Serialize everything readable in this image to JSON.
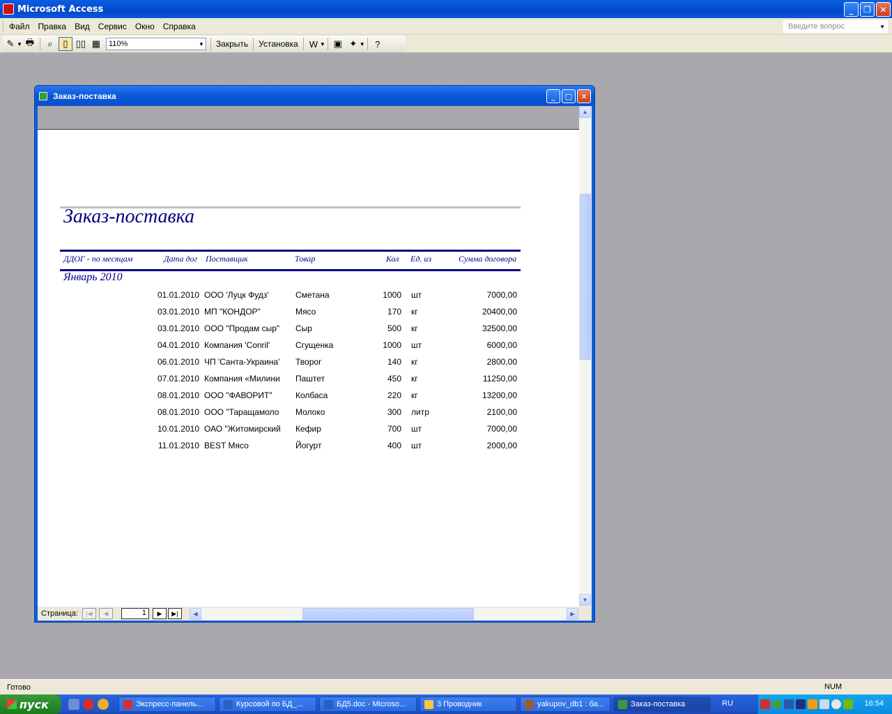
{
  "app": {
    "title": "Microsoft Access",
    "window_buttons": [
      "_",
      "❐",
      "✕"
    ]
  },
  "menu": {
    "items": [
      {
        "label": "Файл"
      },
      {
        "label": "Правка"
      },
      {
        "label": "Вид"
      },
      {
        "label": "Сервис"
      },
      {
        "label": "Окно"
      },
      {
        "label": "Справка"
      }
    ],
    "help_placeholder": "Введите вопрос"
  },
  "toolbar": {
    "zoom": "110%",
    "close_label": "Закрыть",
    "setup_label": "Установка",
    "icons": [
      "design-view-icon",
      "print-icon",
      "zoom-icon",
      "one-page-icon",
      "two-pages-icon",
      "multiple-pages-icon",
      "office-links-icon",
      "database-window-icon",
      "new-object-icon",
      "help-icon"
    ]
  },
  "report_window": {
    "title": "Заказ-поставка",
    "report": {
      "title": "Заказ-поставка",
      "columns": [
        "ДДОГ - по месяцам",
        "Дата дог",
        "Поставщик",
        "Товар",
        "Кол",
        "Ед. из",
        "Сумма договора"
      ],
      "group_label": "Январь 2010",
      "rows": [
        {
          "date": "01.01.2010",
          "supplier": "ООО 'Луцк Фудз'",
          "item": "Сметана",
          "qty": "1000",
          "unit": "шт",
          "sum": "7000,00"
        },
        {
          "date": "03.01.2010",
          "supplier": "МП \"КОНДОР\"",
          "item": "Мясо",
          "qty": "170",
          "unit": "кг",
          "sum": "20400,00"
        },
        {
          "date": "03.01.2010",
          "supplier": "ООО \"Продам сыр\"",
          "item": "Сыр",
          "qty": "500",
          "unit": "кг",
          "sum": "32500,00"
        },
        {
          "date": "04.01.2010",
          "supplier": "Компания 'Conril'",
          "item": "Сгущенка",
          "qty": "1000",
          "unit": "шт",
          "sum": "6000,00"
        },
        {
          "date": "06.01.2010",
          "supplier": "ЧП 'Санта-Украина'",
          "item": "Творог",
          "qty": "140",
          "unit": "кг",
          "sum": "2800,00"
        },
        {
          "date": "07.01.2010",
          "supplier": "Компания «Милини",
          "item": "Паштет",
          "qty": "450",
          "unit": "кг",
          "sum": "11250,00"
        },
        {
          "date": "08.01.2010",
          "supplier": "ООО \"ФАВОРИТ\"",
          "item": "Колбаса",
          "qty": "220",
          "unit": "кг",
          "sum": "13200,00"
        },
        {
          "date": "08.01.2010",
          "supplier": "ООО \"Таращамоло",
          "item": "Молоко",
          "qty": "300",
          "unit": "литр",
          "sum": "2100,00"
        },
        {
          "date": "10.01.2010",
          "supplier": "ОАО \"Житомирский",
          "item": "Кефир",
          "qty": "700",
          "unit": "шт",
          "sum": "7000,00"
        },
        {
          "date": "11.01.2010",
          "supplier": "BEST Мясо",
          "item": "Йогурт",
          "qty": "400",
          "unit": "шт",
          "sum": "2000,00"
        }
      ]
    },
    "nav": {
      "page_label": "Страница:",
      "page_number": "1"
    }
  },
  "status": {
    "text": "Готово",
    "num": "NUM"
  },
  "taskbar": {
    "start_label": "пуск",
    "tasks": [
      {
        "label": "Экспресс-панель...",
        "color": "#d32f2f"
      },
      {
        "label": "Курсовой по БД_...",
        "color": "#2b5fc2"
      },
      {
        "label": "БД5.doc - Microso...",
        "color": "#2b5fc2"
      },
      {
        "label": "3 Проводник",
        "color": "#f5c542"
      },
      {
        "label": "yakupov_db1 : ба...",
        "color": "#a05a2c"
      },
      {
        "label": "Заказ-поставка",
        "color": "#3a9a3a"
      }
    ],
    "lang": "RU",
    "clock": "16:54"
  }
}
